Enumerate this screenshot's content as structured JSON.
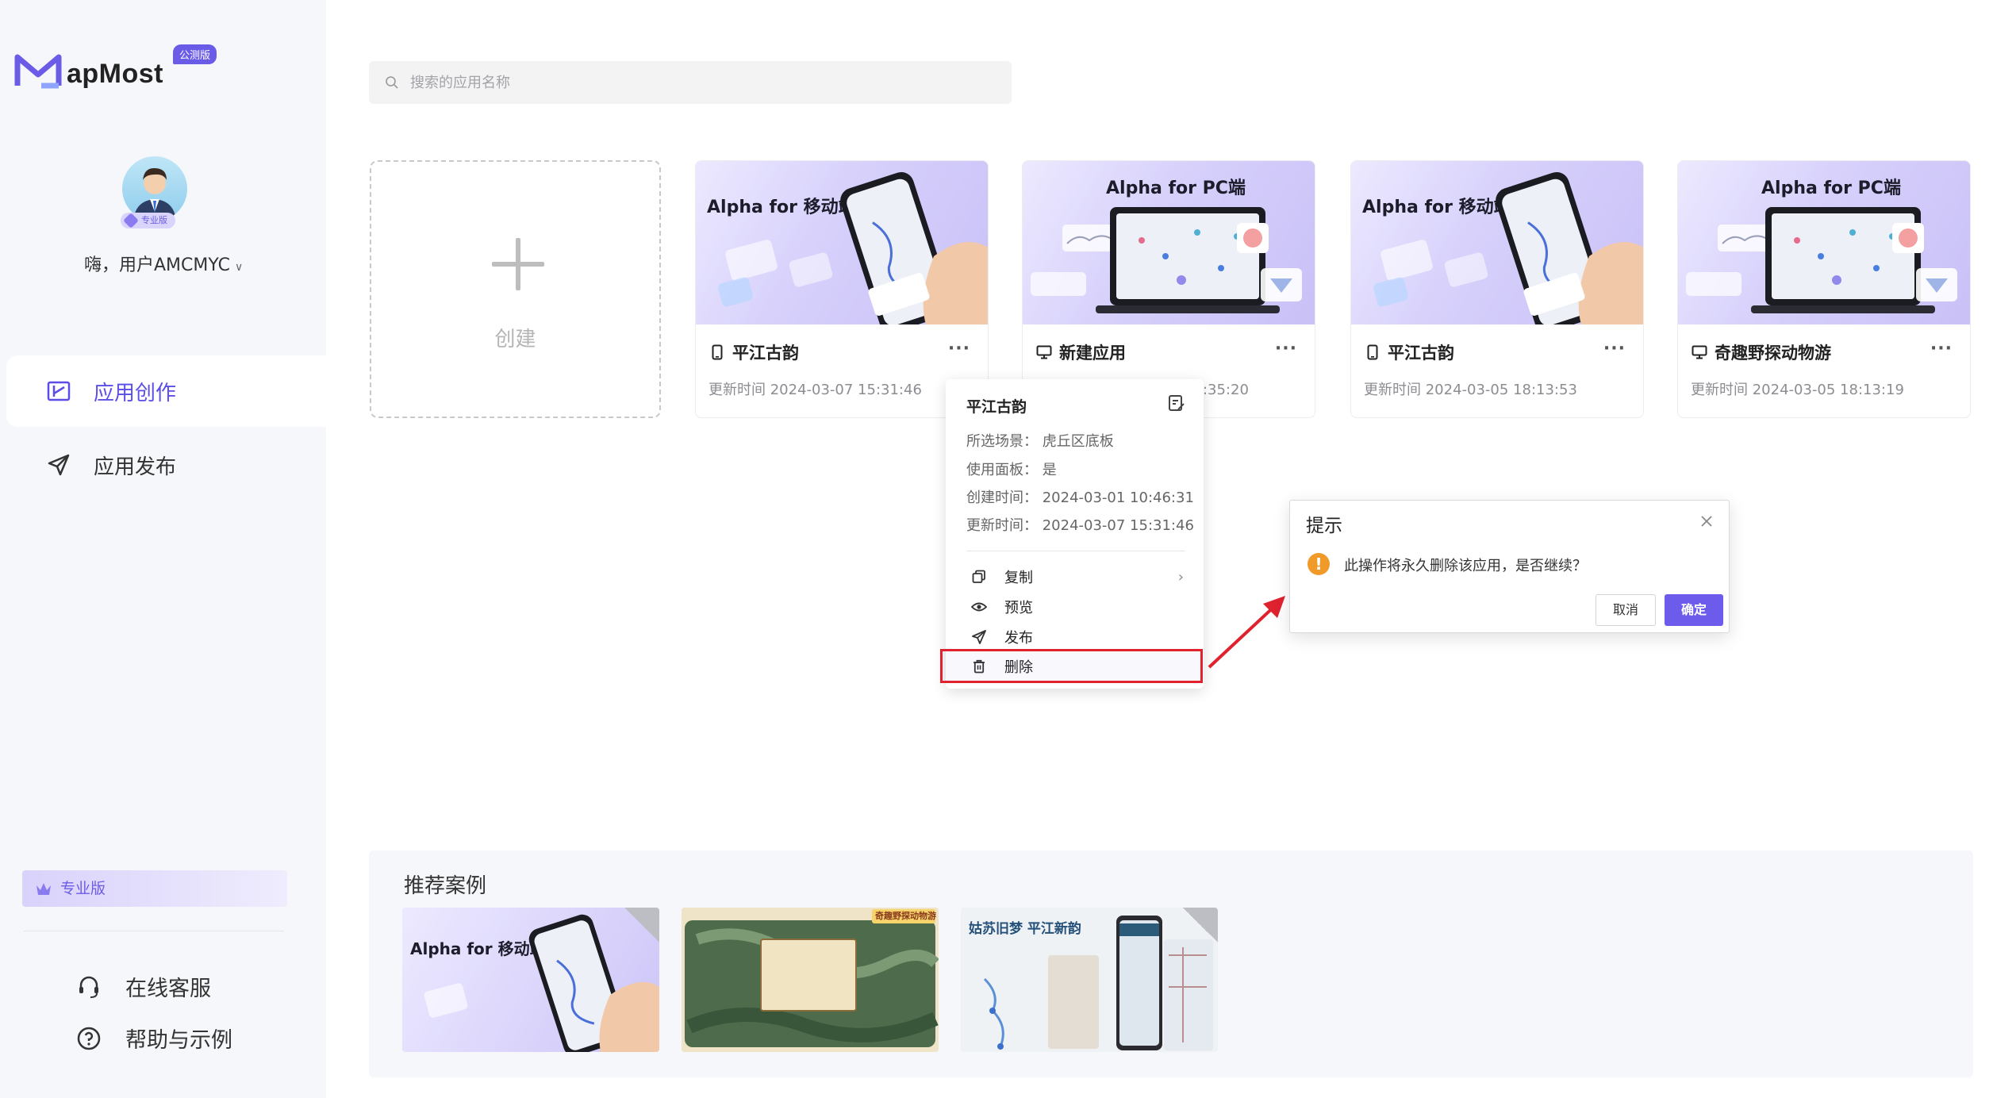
{
  "brand": {
    "name": "apMost",
    "badge": "公测版"
  },
  "user": {
    "greeting": "嗨，用户AMCMYC",
    "badge": "专业版"
  },
  "nav": [
    {
      "label": "应用创作",
      "icon": "create-icon",
      "active": true
    },
    {
      "label": "应用发布",
      "icon": "send-icon",
      "active": false
    }
  ],
  "sidebar_bottom": {
    "pro_label": "专业版",
    "support": "在线客服",
    "help": "帮助与示例"
  },
  "search": {
    "placeholder": "搜索的应用名称"
  },
  "create": {
    "label": "创建"
  },
  "apps": [
    {
      "thumb_title": "Alpha for 移动端",
      "kind": "mobile",
      "name": "平江古韵",
      "updated": "更新时间 2024-03-07 15:31:46",
      "more": "···"
    },
    {
      "thumb_title": "Alpha for PC端",
      "kind": "pc",
      "name": "新建应用",
      "updated": "更新时间 2024-03-07 15:35:20",
      "more": "···"
    },
    {
      "thumb_title": "Alpha for 移动端",
      "kind": "mobile",
      "name": "平江古韵",
      "updated": "更新时间 2024-03-05 18:13:53",
      "more": "···"
    },
    {
      "thumb_title": "Alpha for PC端",
      "kind": "pc",
      "name": "奇趣野探动物游",
      "updated": "更新时间 2024-03-05 18:13:19",
      "more": "···"
    }
  ],
  "popover": {
    "title": "平江古韵",
    "rows": [
      "所选场景：  虎丘区底板",
      "使用面板：  是",
      "创建时间：  2024-03-01 10:46:31",
      "更新时间：  2024-03-07 15:31:46"
    ],
    "actions": [
      {
        "label": "复制",
        "icon": "copy-icon",
        "has_arrow": true
      },
      {
        "label": "预览",
        "icon": "eye-icon",
        "has_arrow": false
      },
      {
        "label": "发布",
        "icon": "send-icon",
        "has_arrow": false
      },
      {
        "label": "删除",
        "icon": "trash-icon",
        "has_arrow": false
      }
    ]
  },
  "dialog": {
    "title": "提示",
    "message": "此操作将永久删除该应用，是否继续？",
    "cancel": "取消",
    "confirm": "确定"
  },
  "recommended": {
    "title": "推荐案例",
    "items": [
      {
        "title": "Alpha for 移动端"
      },
      {
        "title": "奇趣野探动物游"
      },
      {
        "title": "姑苏旧梦 平江新韵"
      }
    ]
  },
  "colors": {
    "accent": "#5b4ee8",
    "highlight": "#e0212e",
    "warning": "#f09a2a"
  }
}
